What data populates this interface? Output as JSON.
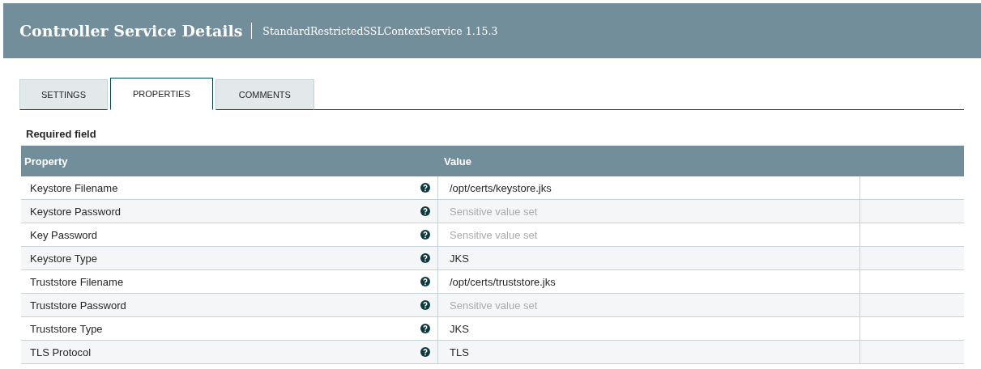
{
  "header": {
    "title": "Controller Service Details",
    "subtitle": "StandardRestrictedSSLContextService 1.15.3"
  },
  "tabs": [
    {
      "label": "SETTINGS",
      "selected": false
    },
    {
      "label": "PROPERTIES",
      "selected": true
    },
    {
      "label": "COMMENTS",
      "selected": false
    }
  ],
  "required_note": "Required field",
  "table": {
    "columns": [
      "Property",
      "Value"
    ],
    "rows": [
      {
        "property": "Keystore Filename",
        "value": "/opt/certs/keystore.jks",
        "sensitive": false
      },
      {
        "property": "Keystore Password",
        "value": "Sensitive value set",
        "sensitive": true
      },
      {
        "property": "Key Password",
        "value": "Sensitive value set",
        "sensitive": true
      },
      {
        "property": "Keystore Type",
        "value": "JKS",
        "sensitive": false
      },
      {
        "property": "Truststore Filename",
        "value": "/opt/certs/truststore.jks",
        "sensitive": false
      },
      {
        "property": "Truststore Password",
        "value": "Sensitive value set",
        "sensitive": true
      },
      {
        "property": "Truststore Type",
        "value": "JKS",
        "sensitive": false
      },
      {
        "property": "TLS Protocol",
        "value": "TLS",
        "sensitive": false
      }
    ]
  }
}
